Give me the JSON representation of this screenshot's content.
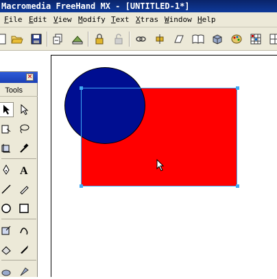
{
  "window": {
    "title": "Macromedia FreeHand MX - [UNTITLED-1*]"
  },
  "menu": {
    "items": [
      "File",
      "Edit",
      "View",
      "Modify",
      "Text",
      "Xtras",
      "Window",
      "Help"
    ],
    "accelerators": [
      "F",
      "E",
      "V",
      "M",
      "T",
      "X",
      "W",
      "H"
    ]
  },
  "toolbar": {
    "buttons": [
      "new-document",
      "open",
      "save",
      "import",
      "export",
      "lock",
      "unlock",
      "link",
      "duplicate",
      "transform",
      "library",
      "3d",
      "color-mixer",
      "swatches",
      "align"
    ]
  },
  "tools_panel": {
    "title": "Tools",
    "close_label": "×"
  },
  "canvas": {
    "shapes": [
      {
        "name": "rectangle",
        "fill": "#ff0000"
      },
      {
        "name": "ellipse",
        "fill": "#000e91",
        "stroke": "#000000"
      }
    ],
    "selection_color": "#3fa9f5"
  }
}
